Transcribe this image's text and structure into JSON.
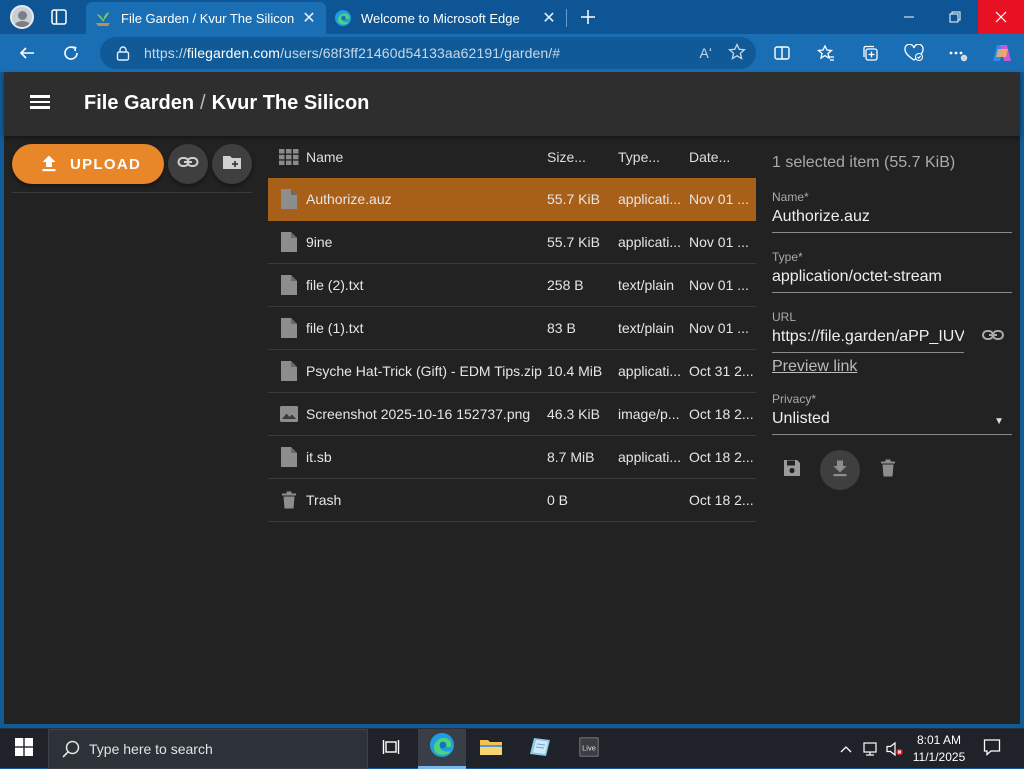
{
  "browser": {
    "tabs": [
      {
        "title": "File Garden / Kvur The Silicon",
        "active": true
      },
      {
        "title": "Welcome to Microsoft Edge",
        "active": false
      }
    ],
    "url": {
      "scheme": "https://",
      "host": "filegarden.com",
      "path": "/users/68f3ff21460d54133aa62191/garden/#"
    },
    "read_aloud_glyph": "Aʻ"
  },
  "app": {
    "title": "File Garden",
    "separator": "/",
    "subtitle": "Kvur The Silicon",
    "upload_label": "UPLOAD"
  },
  "table": {
    "headers": {
      "name": "Name",
      "size": "Size...",
      "type": "Type...",
      "date": "Date..."
    },
    "rows": [
      {
        "icon": "file-icon",
        "name": "Authorize.auz",
        "size": "55.7 KiB",
        "type": "applicati...",
        "date": "Nov 01 ...",
        "selected": true
      },
      {
        "icon": "file-icon",
        "name": "9ine",
        "size": "55.7 KiB",
        "type": "applicati...",
        "date": "Nov 01 ...",
        "selected": false
      },
      {
        "icon": "file-icon",
        "name": "file (2).txt",
        "size": "258 B",
        "type": "text/plain",
        "date": "Nov 01 ...",
        "selected": false
      },
      {
        "icon": "file-icon",
        "name": "file (1).txt",
        "size": "83 B",
        "type": "text/plain",
        "date": "Nov 01 ...",
        "selected": false
      },
      {
        "icon": "file-icon",
        "name": "Psyche Hat-Trick (Gift) - EDM Tips.zip",
        "size": "10.4 MiB",
        "type": "applicati...",
        "date": "Oct 31 2...",
        "selected": false
      },
      {
        "icon": "image-icon",
        "name": "Screenshot 2025-10-16 152737.png",
        "size": "46.3 KiB",
        "type": "image/p...",
        "date": "Oct 18 2...",
        "selected": false
      },
      {
        "icon": "file-icon",
        "name": "it.sb",
        "size": "8.7 MiB",
        "type": "applicati...",
        "date": "Oct 18 2...",
        "selected": false
      },
      {
        "icon": "trash-icon",
        "name": "Trash",
        "size": "0 B",
        "type": "",
        "date": "Oct 18 2...",
        "selected": false
      }
    ]
  },
  "detail": {
    "selection_summary": "1 selected item (55.7 KiB)",
    "name_label": "Name*",
    "name_value": "Authorize.auz",
    "type_label": "Type*",
    "type_value": "application/octet-stream",
    "url_label": "URL",
    "url_value": "https://file.garden/aPP_IUVd",
    "preview_link": "Preview link",
    "privacy_label": "Privacy*",
    "privacy_value": "Unlisted"
  },
  "taskbar": {
    "search_placeholder": "Type here to search",
    "time": "8:01 AM",
    "date": "11/1/2025"
  },
  "colors": {
    "accent": "#e8862a",
    "selected_row": "#a85f18",
    "app_background": "#222223",
    "appbar": "#2e2e2f",
    "browser_titlebar": "#0d5595",
    "browser_toolbar": "#1a6fb4"
  }
}
